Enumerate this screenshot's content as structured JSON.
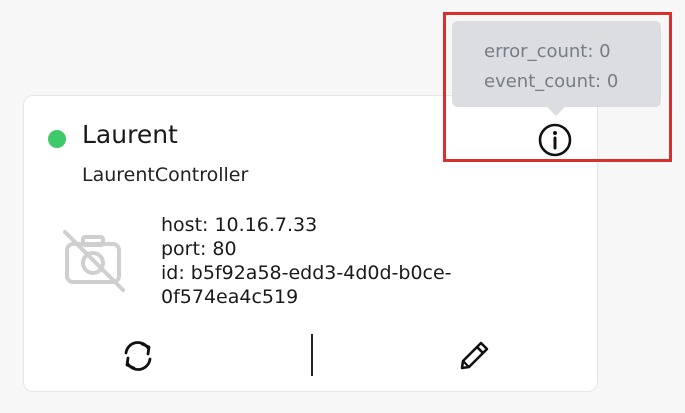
{
  "colors": {
    "status_online": "#3ec96b",
    "highlight": "#d9302e"
  },
  "card": {
    "name": "Laurent",
    "type": "LaurentController",
    "status": "online",
    "details": {
      "host": "host: 10.16.7.33",
      "port": "port: 80",
      "id_line1": "id: b5f92a58-edd3-4d0d-b0ce-",
      "id_line2": "0f574ea4c519"
    },
    "icons": {
      "info": "info-icon",
      "camera": "camera-off-icon",
      "refresh": "refresh-icon",
      "edit": "pencil-icon"
    }
  },
  "tooltip": {
    "error_count": "error_count: 0",
    "event_count": "event_count: 0"
  }
}
